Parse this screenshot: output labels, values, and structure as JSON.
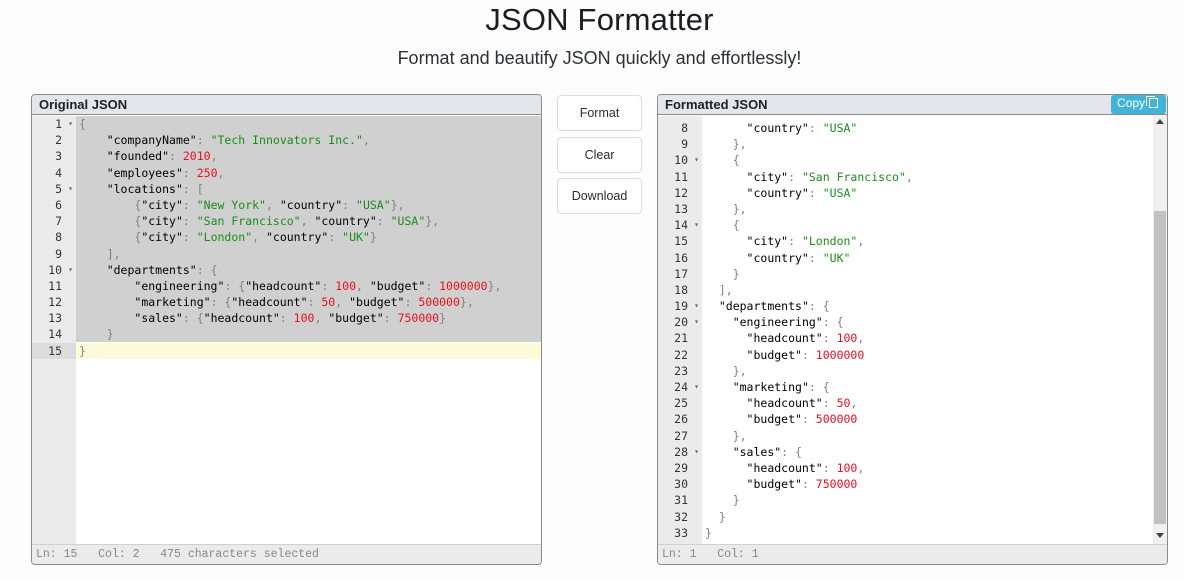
{
  "header": {
    "title": "JSON Formatter",
    "subtitle": "Format and beautify JSON quickly and effortlessly!"
  },
  "original": {
    "title": "Original JSON",
    "status": "Ln: 15   Col: 2   475 characters selected",
    "active_line": 15,
    "lines": [
      {
        "n": "1",
        "fold": true,
        "html": "<span class='p'>{</span>"
      },
      {
        "n": "2",
        "html": "    <span class='k'>\"companyName\"</span><span class='p'>: </span><span class='s'>\"Tech Innovators Inc.\"</span><span class='p'>,</span>"
      },
      {
        "n": "3",
        "html": "    <span class='k'>\"founded\"</span><span class='p'>: </span><span class='n'>2010</span><span class='p'>,</span>"
      },
      {
        "n": "4",
        "html": "    <span class='k'>\"employees\"</span><span class='p'>: </span><span class='n'>250</span><span class='p'>,</span>"
      },
      {
        "n": "5",
        "fold": true,
        "html": "    <span class='k'>\"locations\"</span><span class='p'>: [</span>"
      },
      {
        "n": "6",
        "html": "        <span class='p'>{</span><span class='k'>\"city\"</span><span class='p'>: </span><span class='s'>\"New York\"</span><span class='p'>, </span><span class='k'>\"country\"</span><span class='p'>: </span><span class='s'>\"USA\"</span><span class='p'>},</span>"
      },
      {
        "n": "7",
        "html": "        <span class='p'>{</span><span class='k'>\"city\"</span><span class='p'>: </span><span class='s'>\"San Francisco\"</span><span class='p'>, </span><span class='k'>\"country\"</span><span class='p'>: </span><span class='s'>\"USA\"</span><span class='p'>},</span>"
      },
      {
        "n": "8",
        "html": "        <span class='p'>{</span><span class='k'>\"city\"</span><span class='p'>: </span><span class='s'>\"London\"</span><span class='p'>, </span><span class='k'>\"country\"</span><span class='p'>: </span><span class='s'>\"UK\"</span><span class='p'>}</span>"
      },
      {
        "n": "9",
        "html": "    <span class='p'>],</span>"
      },
      {
        "n": "10",
        "fold": true,
        "html": "    <span class='k'>\"departments\"</span><span class='p'>: {</span>"
      },
      {
        "n": "11",
        "html": "        <span class='k'>\"engineering\"</span><span class='p'>: {</span><span class='k'>\"headcount\"</span><span class='p'>: </span><span class='n'>100</span><span class='p'>, </span><span class='k'>\"budget\"</span><span class='p'>: </span><span class='n'>1000000</span><span class='p'>},</span>"
      },
      {
        "n": "12",
        "html": "        <span class='k'>\"marketing\"</span><span class='p'>: {</span><span class='k'>\"headcount\"</span><span class='p'>: </span><span class='n'>50</span><span class='p'>, </span><span class='k'>\"budget\"</span><span class='p'>: </span><span class='n'>500000</span><span class='p'>},</span>"
      },
      {
        "n": "13",
        "html": "        <span class='k'>\"sales\"</span><span class='p'>: {</span><span class='k'>\"headcount\"</span><span class='p'>: </span><span class='n'>100</span><span class='p'>, </span><span class='k'>\"budget\"</span><span class='p'>: </span><span class='n'>750000</span><span class='p'>}</span>"
      },
      {
        "n": "14",
        "html": "    <span class='p'>}</span>"
      },
      {
        "n": "15",
        "html": "<span class='p'>}</span>"
      }
    ]
  },
  "actions": {
    "format": "Format",
    "clear": "Clear",
    "download": "Download"
  },
  "formatted": {
    "title": "Formatted JSON",
    "copy_label": "Copy",
    "status": "Ln: 1   Col: 1",
    "scroll_fraction": 0.21,
    "lines": [
      {
        "n": "8",
        "html": "      <span class='k'>\"country\"</span><span class='p'>: </span><span class='s'>\"USA\"</span>"
      },
      {
        "n": "9",
        "html": "    <span class='p'>},</span>"
      },
      {
        "n": "10",
        "fold": true,
        "html": "    <span class='p'>{</span>"
      },
      {
        "n": "11",
        "html": "      <span class='k'>\"city\"</span><span class='p'>: </span><span class='s'>\"San Francisco\"</span><span class='p'>,</span>"
      },
      {
        "n": "12",
        "html": "      <span class='k'>\"country\"</span><span class='p'>: </span><span class='s'>\"USA\"</span>"
      },
      {
        "n": "13",
        "html": "    <span class='p'>},</span>"
      },
      {
        "n": "14",
        "fold": true,
        "html": "    <span class='p'>{</span>"
      },
      {
        "n": "15",
        "html": "      <span class='k'>\"city\"</span><span class='p'>: </span><span class='s'>\"London\"</span><span class='p'>,</span>"
      },
      {
        "n": "16",
        "html": "      <span class='k'>\"country\"</span><span class='p'>: </span><span class='s'>\"UK\"</span>"
      },
      {
        "n": "17",
        "html": "    <span class='p'>}</span>"
      },
      {
        "n": "18",
        "html": "  <span class='p'>],</span>"
      },
      {
        "n": "19",
        "fold": true,
        "html": "  <span class='k'>\"departments\"</span><span class='p'>: {</span>"
      },
      {
        "n": "20",
        "fold": true,
        "html": "    <span class='k'>\"engineering\"</span><span class='p'>: {</span>"
      },
      {
        "n": "21",
        "html": "      <span class='k'>\"headcount\"</span><span class='p'>: </span><span class='n'>100</span><span class='p'>,</span>"
      },
      {
        "n": "22",
        "html": "      <span class='k'>\"budget\"</span><span class='p'>: </span><span class='n'>1000000</span>"
      },
      {
        "n": "23",
        "html": "    <span class='p'>},</span>"
      },
      {
        "n": "24",
        "fold": true,
        "html": "    <span class='k'>\"marketing\"</span><span class='p'>: {</span>"
      },
      {
        "n": "25",
        "html": "      <span class='k'>\"headcount\"</span><span class='p'>: </span><span class='n'>50</span><span class='p'>,</span>"
      },
      {
        "n": "26",
        "html": "      <span class='k'>\"budget\"</span><span class='p'>: </span><span class='n'>500000</span>"
      },
      {
        "n": "27",
        "html": "    <span class='p'>},</span>"
      },
      {
        "n": "28",
        "fold": true,
        "html": "    <span class='k'>\"sales\"</span><span class='p'>: {</span>"
      },
      {
        "n": "29",
        "html": "      <span class='k'>\"headcount\"</span><span class='p'>: </span><span class='n'>100</span><span class='p'>,</span>"
      },
      {
        "n": "30",
        "html": "      <span class='k'>\"budget\"</span><span class='p'>: </span><span class='n'>750000</span>"
      },
      {
        "n": "31",
        "html": "    <span class='p'>}</span>"
      },
      {
        "n": "32",
        "html": "  <span class='p'>}</span>"
      },
      {
        "n": "33",
        "html": "<span class='p'>}</span>"
      }
    ]
  }
}
